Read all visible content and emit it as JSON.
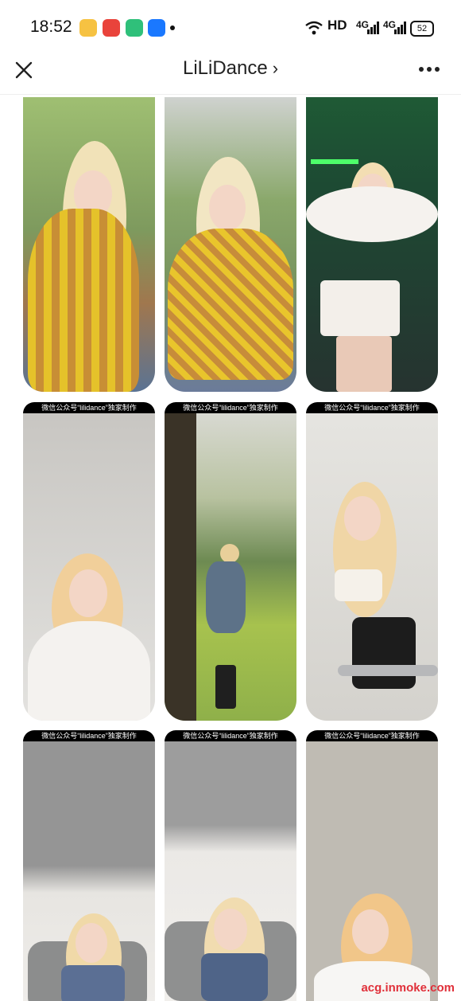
{
  "status": {
    "time": "18:52",
    "hd": "HD",
    "net1": "4G",
    "net2": "4G",
    "battery": "52"
  },
  "nav": {
    "title": "LiLiDance",
    "chevron": "›"
  },
  "banner": "微信公众号“lilidance”独家制作",
  "tiles": [
    {
      "bg": "#8ea86a"
    },
    {
      "bg": "#8aa36a"
    },
    {
      "bg": "#2a3a34"
    },
    {
      "bg": "#c5c3bf"
    },
    {
      "bg": "#a7b86c"
    },
    {
      "bg": "#d6d3cf"
    },
    {
      "bg": "#949494"
    },
    {
      "bg": "#9c9c9c"
    },
    {
      "bg": "#bfbbb3"
    }
  ],
  "watermark": "acg.inmoke.com"
}
